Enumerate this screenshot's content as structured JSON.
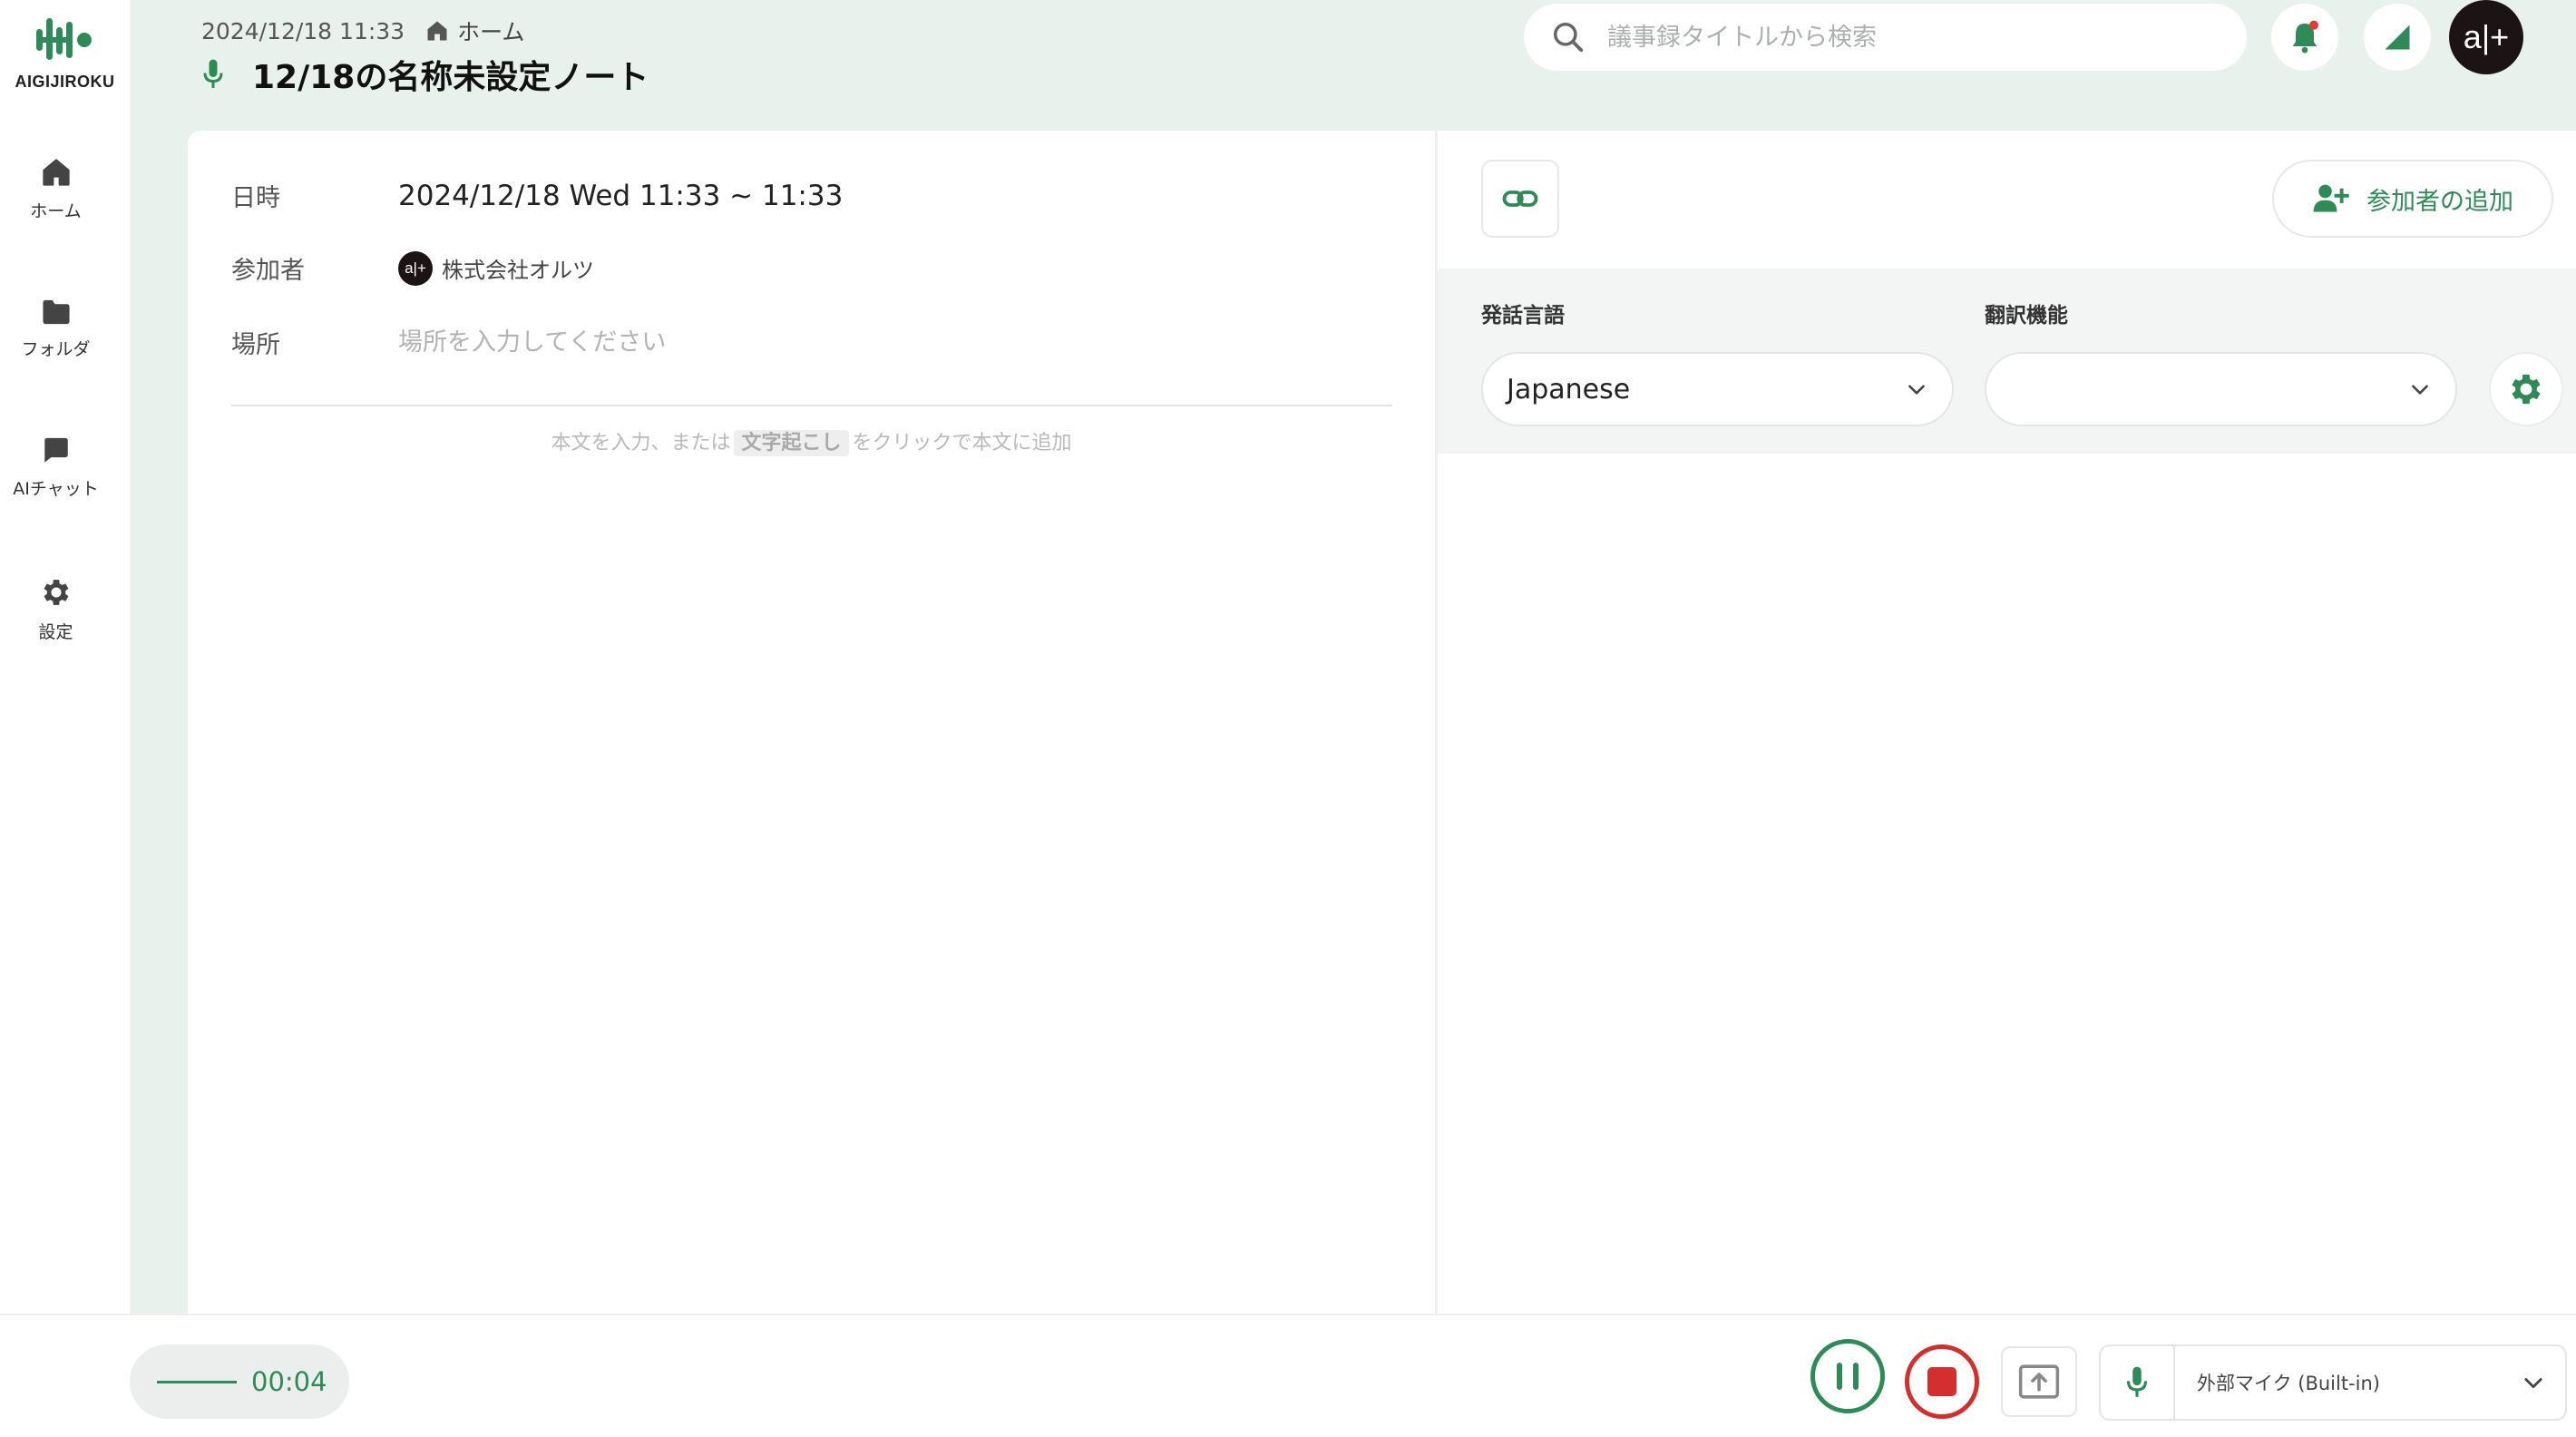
{
  "app": {
    "logo_text": "AIGIJIROKU",
    "accent": "#2e8b57"
  },
  "sidebar": {
    "items": [
      {
        "label": "ホーム",
        "icon": "home-icon"
      },
      {
        "label": "フォルダ",
        "icon": "folder-icon"
      },
      {
        "label": "AIチャット",
        "icon": "chat-icon"
      },
      {
        "label": "設定",
        "icon": "gear-icon"
      }
    ]
  },
  "header": {
    "timestamp": "2024/12/18 11:33",
    "breadcrumb": "ホーム",
    "title": "12/18の名称未設定ノート"
  },
  "search": {
    "placeholder": "議事録タイトルから検索"
  },
  "user": {
    "avatar_text": "a|+"
  },
  "note": {
    "date_label": "日時",
    "date_value": "2024/12/18 Wed 11:33 ~ 11:33",
    "participants_label": "参加者",
    "participant_name": "株式会社オルツ",
    "participant_avatar": "a|+",
    "place_label": "場所",
    "place_placeholder": "場所を入力してください",
    "body_hint_before": "本文を入力、または",
    "body_hint_chip": "文字起こし",
    "body_hint_after": "をクリックで本文に追加"
  },
  "transcript": {
    "add_participant": "参加者の追加",
    "speech_lang_label": "発話言語",
    "speech_lang_value": "Japanese",
    "translation_label": "翻訳機能",
    "translation_value": ""
  },
  "recorder": {
    "elapsed": "00:04",
    "mic_device": "外部マイク (Built-in)",
    "pause_color": "#2e8b57",
    "stop_color": "#d32f2f"
  }
}
